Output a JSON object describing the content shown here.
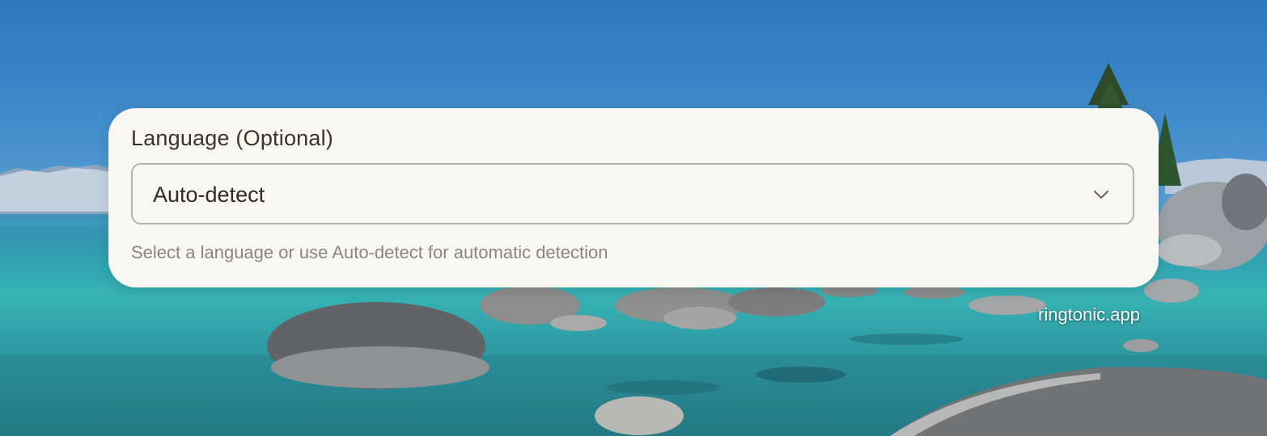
{
  "language_field": {
    "label": "Language (Optional)",
    "selected_value": "Auto-detect",
    "helper": "Select a language or use Auto-detect for automatic detection"
  },
  "watermark": {
    "text": "ringtonic.app"
  },
  "icons": {
    "dropdown": "chevron-down-icon"
  },
  "colors": {
    "card_background": "#f8f7f2",
    "label_text": "#3a3529",
    "helper_text": "#8a8680",
    "select_border": "#b5b3ad"
  }
}
